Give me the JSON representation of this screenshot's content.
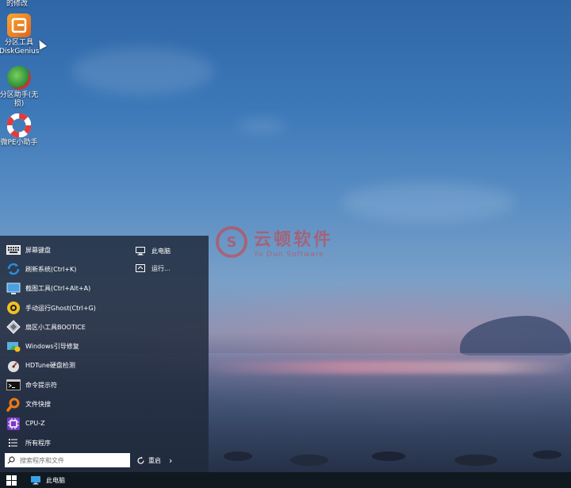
{
  "desktop": {
    "partial_top_label": "的修改",
    "icons": [
      {
        "name": "diskgenius",
        "line1": "分区工具",
        "line2": "DiskGenius",
        "icon": "diskgenius-icon",
        "color": "#f08a1a"
      },
      {
        "name": "partition-assistant",
        "line1": "分区助手(无",
        "line2": "损)",
        "icon": "partition-assistant-icon",
        "color": "#2da84a"
      },
      {
        "name": "wepe-helper",
        "line1": "微PE小助手",
        "line2": "",
        "icon": "lifebuoy-icon",
        "color": "#e23b3b"
      }
    ]
  },
  "watermark": {
    "title": "云顿软件",
    "subtitle": "Yu Dun Software",
    "logo_glyph": "S"
  },
  "start_menu": {
    "items": [
      {
        "label": "屏幕键盘",
        "icon": "keyboard-icon",
        "color": "#d8dde6"
      },
      {
        "label": "刷新系统(Ctrl+K)",
        "icon": "refresh-icon",
        "color": "#2a8ee0"
      },
      {
        "label": "截图工具(Ctrl+Alt+A)",
        "icon": "screenshot-icon",
        "color": "#4aa0e0"
      },
      {
        "label": "手动运行Ghost(Ctrl+G)",
        "icon": "ghost-icon",
        "color": "#f0c020"
      },
      {
        "label": "扇区小工具BOOTICE",
        "icon": "bootice-icon",
        "color": "#c0c4cc"
      },
      {
        "label": "Windows引导修复",
        "icon": "boot-repair-icon",
        "color": "#48a848"
      },
      {
        "label": "HDTune硬盘检测",
        "icon": "hdtune-icon",
        "color": "#e0e0e0"
      },
      {
        "label": "命令提示符",
        "icon": "cmd-icon",
        "color": "#1a1a1a"
      },
      {
        "label": "文件快搜",
        "icon": "file-search-icon",
        "color": "#f07a10"
      },
      {
        "label": "CPU-Z",
        "icon": "cpuz-icon",
        "color": "#7a3ac8"
      },
      {
        "label": "所有程序",
        "icon": "list-icon",
        "color": "transparent"
      }
    ],
    "right_items": [
      {
        "label": "此电脑",
        "icon": "computer-icon"
      },
      {
        "label": "运行...",
        "icon": "run-icon"
      }
    ],
    "search_placeholder": "搜索程序和文件",
    "restart_label": "重启"
  },
  "taskbar": {
    "item_label": "此电脑"
  },
  "colors": {
    "menu_bg": "#202a3c",
    "taskbar_bg": "#101820",
    "watermark": "#d63a3a"
  }
}
